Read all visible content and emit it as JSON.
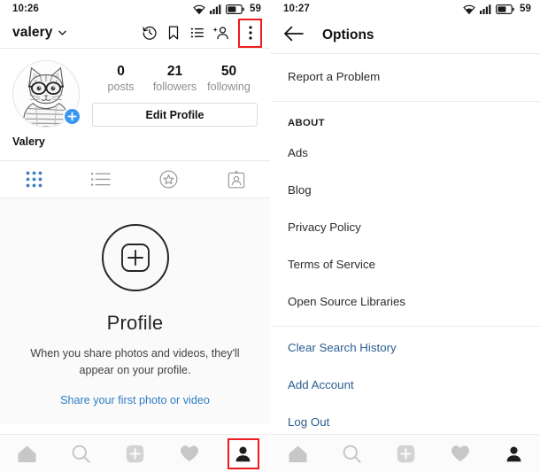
{
  "left": {
    "statusbar": {
      "time": "10:26",
      "battery_level": "59",
      "wifi_icon": "wifi-icon",
      "signal_icon": "signal-bars-icon",
      "battery_icon": "battery-icon"
    },
    "header": {
      "username": "valery",
      "caret_icon": "chevron-down-icon",
      "history_icon": "history-clock-icon",
      "saved_icon": "bookmark-icon",
      "list_icon": "list-icon",
      "discover_people_icon": "add-person-icon",
      "overflow_icon": "more-vertical-icon",
      "overflow_highlighted": true
    },
    "profile": {
      "avatar_icon": "cat-avatar",
      "add_story_icon": "plus-icon",
      "display_name": "Valery",
      "stats": [
        {
          "value": "0",
          "label": "posts"
        },
        {
          "value": "21",
          "label": "followers"
        },
        {
          "value": "50",
          "label": "following"
        }
      ],
      "edit_profile_label": "Edit Profile"
    },
    "tabs": [
      {
        "name": "grid-tab",
        "icon": "grid-icon",
        "active": true
      },
      {
        "name": "list-tab",
        "icon": "list-view-icon",
        "active": false
      },
      {
        "name": "saved-tab",
        "icon": "star-circle-icon",
        "active": false
      },
      {
        "name": "tagged-tab",
        "icon": "tagged-person-icon",
        "active": false
      }
    ],
    "empty_state": {
      "icon": "plus-in-rounded-square-icon",
      "title": "Profile",
      "subtitle": "When you share photos and videos, they'll appear on your profile.",
      "link": "Share your first photo or video"
    },
    "bottomnav": [
      {
        "name": "home-tab",
        "icon": "home-icon",
        "active": false,
        "highlighted": false
      },
      {
        "name": "search-tab",
        "icon": "search-icon",
        "active": false,
        "highlighted": false
      },
      {
        "name": "new-post-tab",
        "icon": "plus-square-icon",
        "active": false,
        "highlighted": false
      },
      {
        "name": "activity-tab",
        "icon": "heart-icon",
        "active": false,
        "highlighted": false
      },
      {
        "name": "profile-tab",
        "icon": "person-icon",
        "active": true,
        "highlighted": true
      }
    ]
  },
  "right": {
    "statusbar": {
      "time": "10:27",
      "battery_level": "59"
    },
    "header": {
      "back_icon": "arrow-left-icon",
      "title": "Options"
    },
    "items": [
      {
        "name": "report-a-problem",
        "label": "Report a Problem",
        "type": "item"
      },
      {
        "name": "about-section-header",
        "label": "ABOUT",
        "type": "section"
      },
      {
        "name": "ads",
        "label": "Ads",
        "type": "item"
      },
      {
        "name": "blog",
        "label": "Blog",
        "type": "item"
      },
      {
        "name": "privacy-policy",
        "label": "Privacy Policy",
        "type": "item"
      },
      {
        "name": "terms-of-service",
        "label": "Terms of Service",
        "type": "item"
      },
      {
        "name": "open-source-libraries",
        "label": "Open Source Libraries",
        "type": "item"
      },
      {
        "name": "clear-search-history",
        "label": "Clear Search History",
        "type": "link"
      },
      {
        "name": "add-account",
        "label": "Add Account",
        "type": "link"
      },
      {
        "name": "log-out",
        "label": "Log Out",
        "type": "link"
      }
    ],
    "bottomnav": [
      {
        "name": "home-tab",
        "icon": "home-icon",
        "active": false
      },
      {
        "name": "search-tab",
        "icon": "search-icon",
        "active": false
      },
      {
        "name": "new-post-tab",
        "icon": "plus-square-icon",
        "active": false
      },
      {
        "name": "activity-tab",
        "icon": "heart-icon",
        "active": false
      },
      {
        "name": "profile-tab",
        "icon": "person-icon",
        "active": true
      }
    ]
  },
  "colors": {
    "accent_blue": "#3897f0",
    "link_blue": "#2a5d91",
    "highlight_red": "#ee1c1c",
    "muted_gray": "#8e8e8e",
    "nav_inactive": "#c7c7c7"
  }
}
